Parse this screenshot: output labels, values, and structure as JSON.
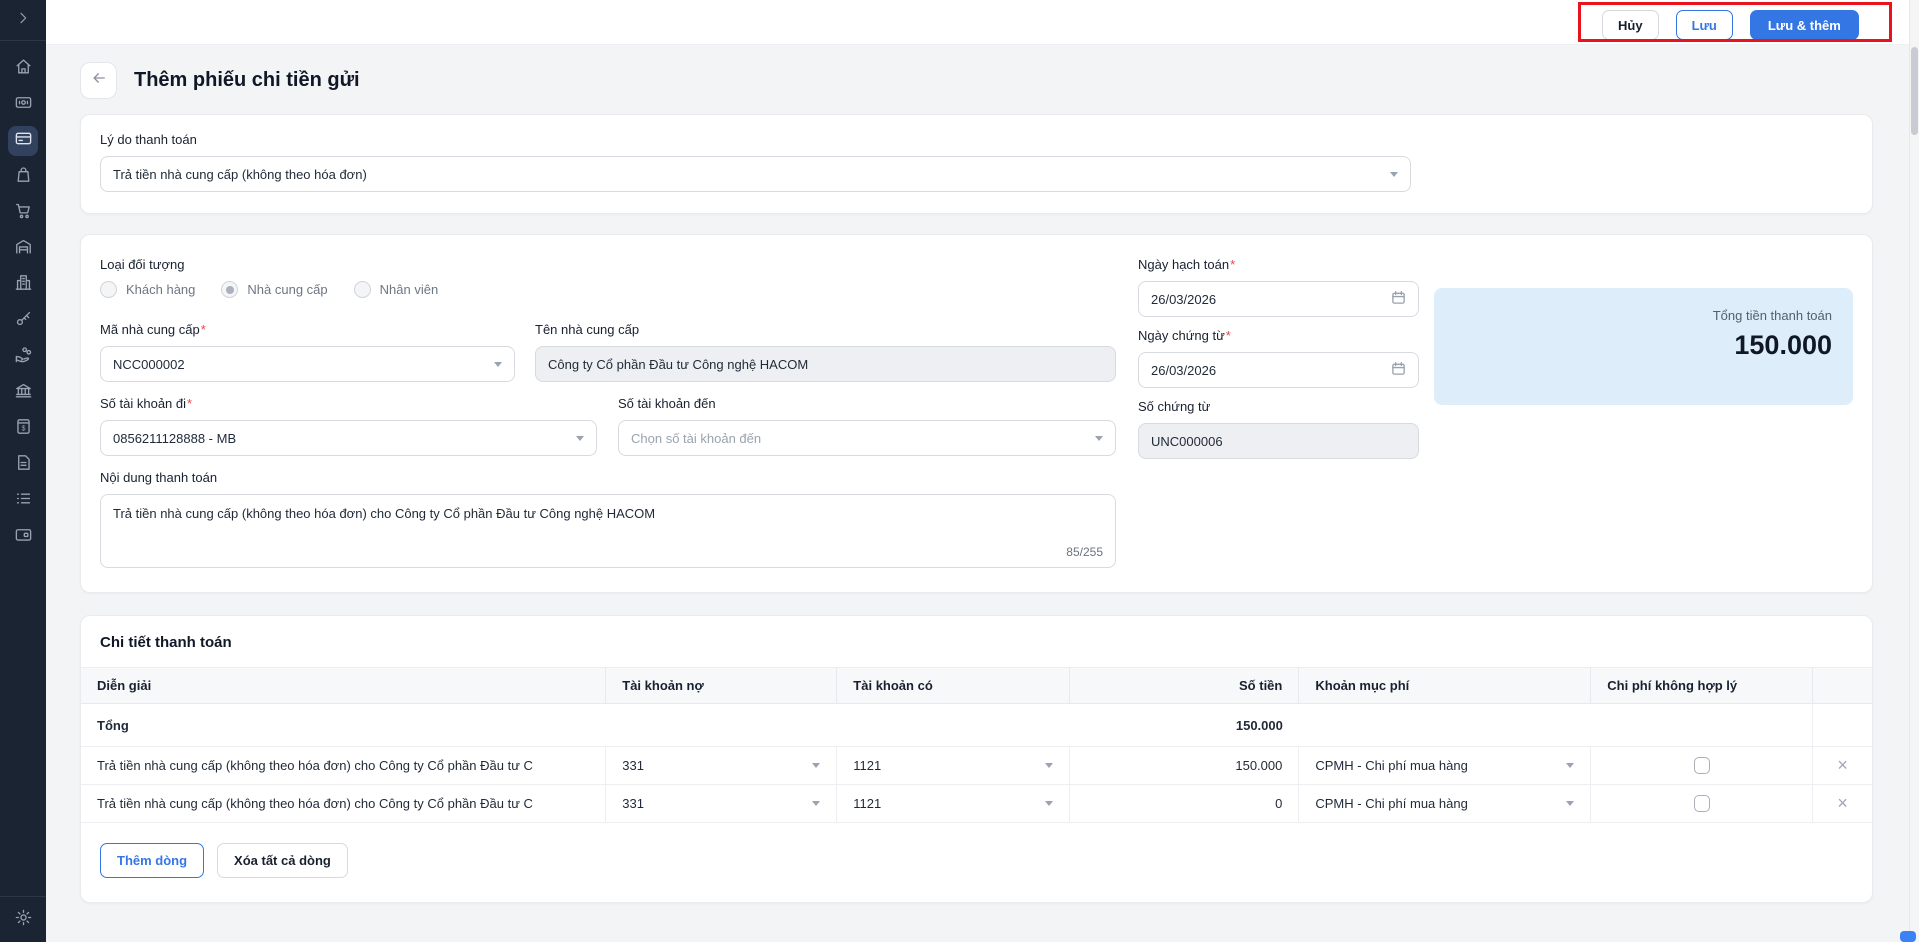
{
  "topbar": {
    "cancel": "Hủy",
    "save": "Lưu",
    "save_and_add": "Lưu & thêm"
  },
  "page": {
    "title": "Thêm phiếu chi tiền gửi"
  },
  "required_mark": "*",
  "reason": {
    "label": "Lý do thanh toán",
    "value": "Trả tiền nhà cung cấp (không theo hóa đơn)"
  },
  "form": {
    "object_type": {
      "label": "Loại đối tượng",
      "options": [
        {
          "label": "Khách hàng",
          "selected": false
        },
        {
          "label": "Nhà cung cấp",
          "selected": true
        },
        {
          "label": "Nhân viên",
          "selected": false
        }
      ]
    },
    "supplier_code": {
      "label": "Mã nhà cung cấp",
      "value": "NCC000002"
    },
    "supplier_name": {
      "label": "Tên nhà cung cấp",
      "value": "Công ty Cổ phần Đầu tư Công nghệ HACOM"
    },
    "account_from": {
      "label": "Số tài khoản đi",
      "value": "0856211128888 - MB"
    },
    "account_to": {
      "label": "Số tài khoản đến",
      "placeholder": "Chọn số tài khoản đến"
    },
    "payment_content": {
      "label": "Nội dung thanh toán",
      "value": "Trả tiền nhà cung cấp (không theo hóa đơn) cho Công ty Cổ phần Đầu tư Công nghệ HACOM",
      "char_counter": "85/255"
    },
    "posting_date": {
      "label": "Ngày hạch toán",
      "value": "26/03/2026"
    },
    "document_date": {
      "label": "Ngày chứng từ",
      "value": "26/03/2026"
    },
    "document_number": {
      "label": "Số chứng từ",
      "value": "UNC000006"
    },
    "total_panel": {
      "label": "Tổng tiền thanh toán",
      "value": "150.000"
    }
  },
  "details": {
    "title": "Chi tiết thanh toán",
    "headers": {
      "description": "Diễn giải",
      "debit": "Tài khoản nợ",
      "credit": "Tài khoản có",
      "amount": "Số tiền",
      "fee": "Khoản mục phí",
      "invalid_expense": "Chi phí không hợp lý"
    },
    "total_row": {
      "label": "Tổng",
      "amount": "150.000"
    },
    "rows": [
      {
        "description": "Trả tiền nhà cung cấp (không theo hóa đơn) cho Công ty Cổ phần Đầu tư C",
        "debit_account": "331",
        "credit_account": "1121",
        "amount": "150.000",
        "fee_category": "CPMH - Chi phí mua hàng",
        "invalid_expense_checked": false
      },
      {
        "description": "Trả tiền nhà cung cấp (không theo hóa đơn) cho Công ty Cổ phần Đầu tư C",
        "debit_account": "331",
        "credit_account": "1121",
        "amount": "0",
        "fee_category": "CPMH - Chi phí mua hàng",
        "invalid_expense_checked": false
      }
    ],
    "add_row": "Thêm dòng",
    "delete_all": "Xóa tất cả dòng"
  },
  "sidebar": {
    "active": "credit-card",
    "icons": [
      "chevron-expand",
      "home",
      "banknote",
      "credit-card",
      "shopping-bag",
      "shopping-cart",
      "warehouse",
      "building",
      "key",
      "hand-coins",
      "bank",
      "invoice",
      "document",
      "list",
      "wallet",
      "settings"
    ]
  },
  "colors": {
    "primary": "#3576e5",
    "sidebar_bg": "#1a2433",
    "annotation_red": "#e8131c",
    "total_panel_bg": "#ddeefa",
    "content_bg": "#f2f4f6"
  }
}
